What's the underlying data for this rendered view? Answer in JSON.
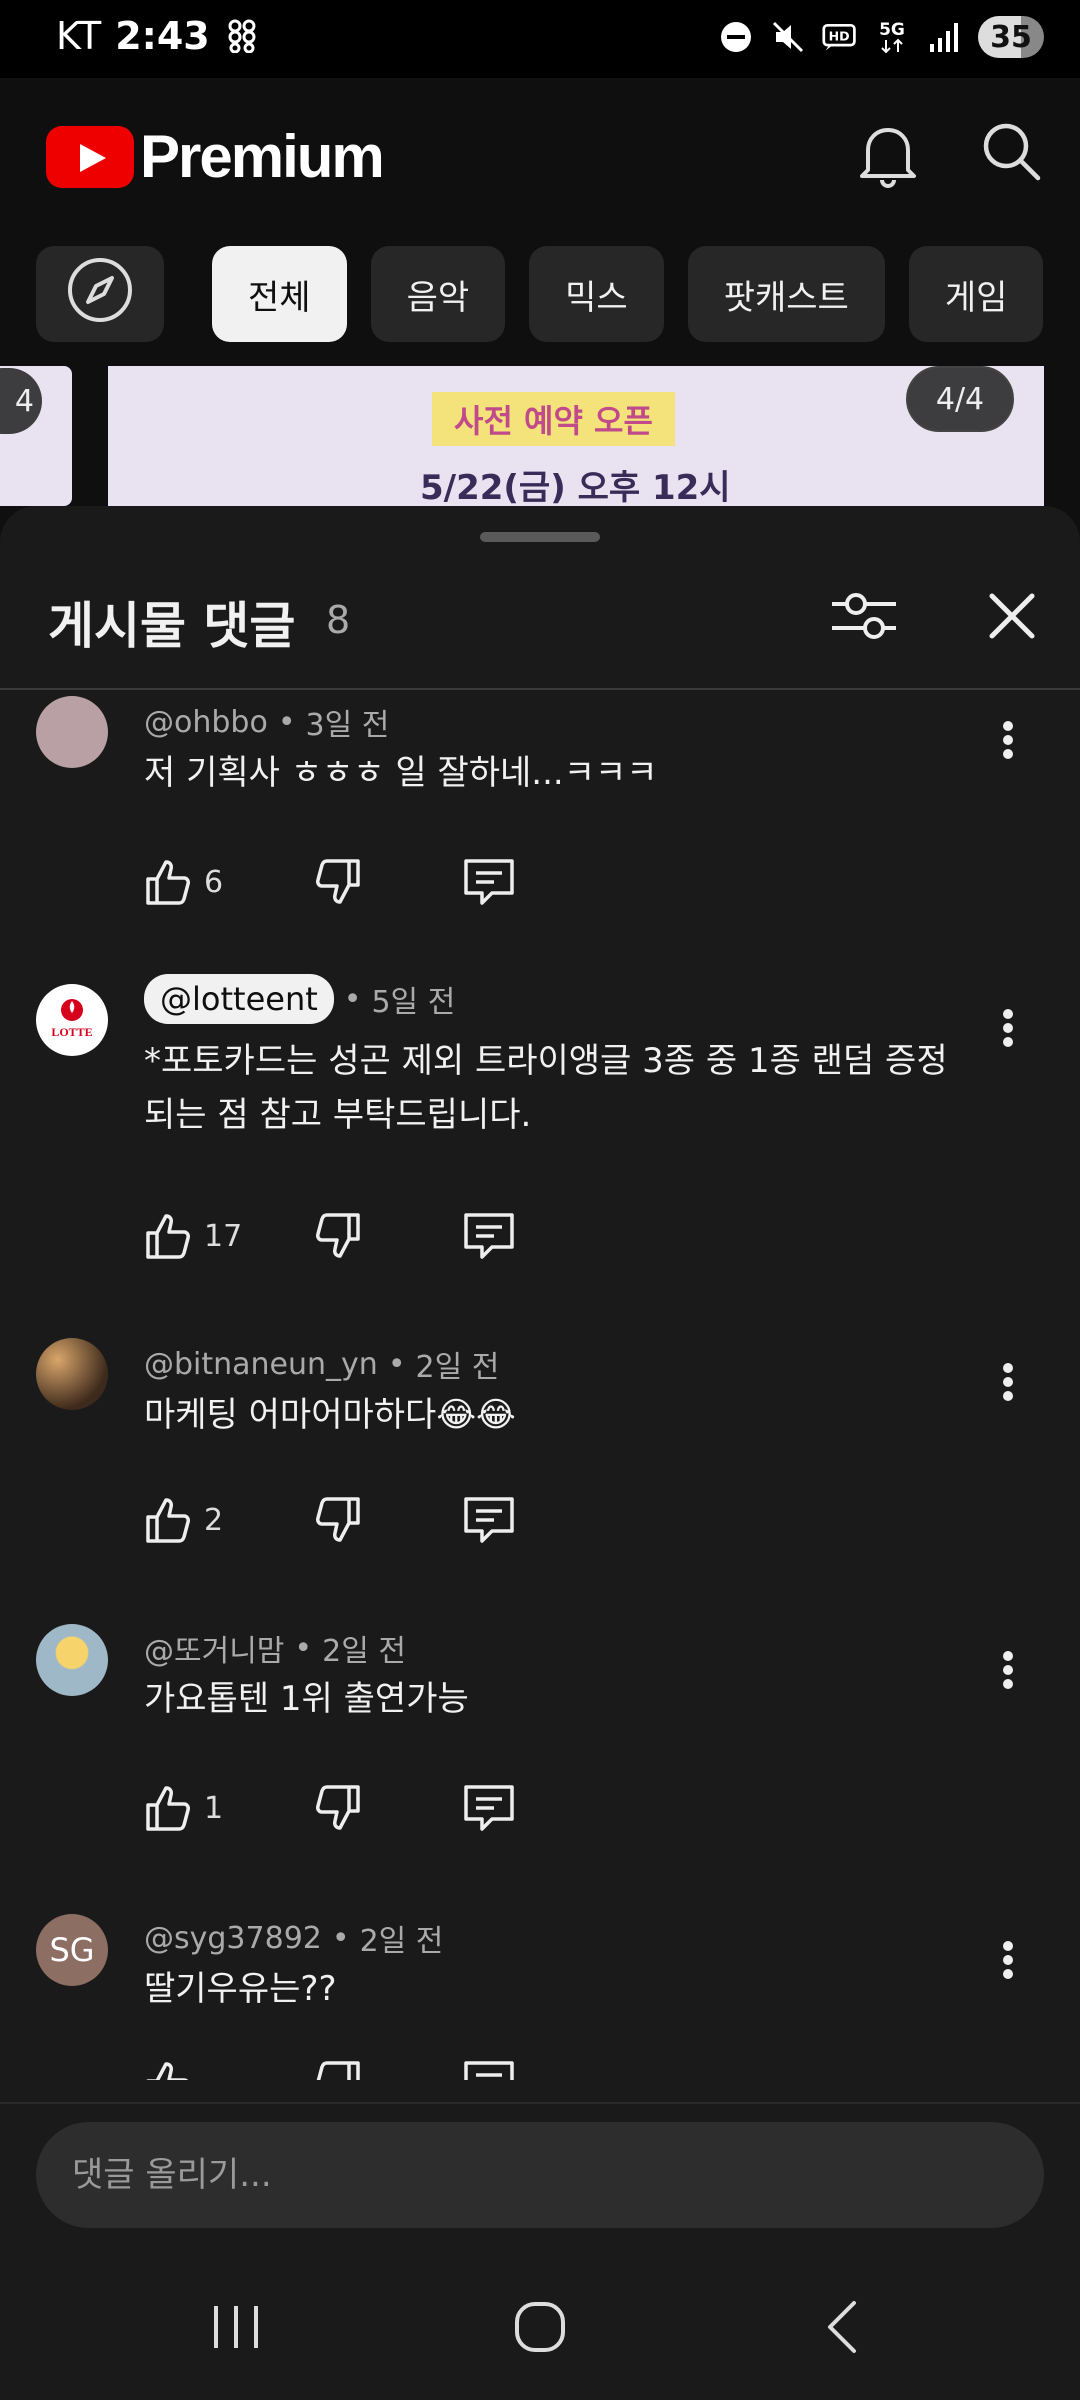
{
  "status_bar": {
    "carrier": "KT",
    "time": "2:43",
    "battery": "35"
  },
  "header": {
    "brand": "Premium"
  },
  "chips": [
    "전체",
    "음악",
    "믹스",
    "팟캐스트",
    "게임"
  ],
  "banner": {
    "line1": "사전 예약 오픈",
    "line2": "5/22(금) 오후 12시",
    "page_indicator": "4/4",
    "prev_indicator": "4"
  },
  "sheet": {
    "title": "게시물 댓글",
    "count": "8"
  },
  "comments": [
    {
      "author": "@ohbbo",
      "time": "3일 전",
      "text": "저 기획사 ㅎㅎㅎ 일 잘하네...ㅋㅋㅋ",
      "likes": "6",
      "avatar_text": "",
      "avatar_color": "#b8a0a4"
    },
    {
      "author": "@lotteent",
      "time": "5일 전",
      "text": "*포토카드는 성곤 제외 트라이앵글 3종 중 1종 랜덤 증정되는 점 참고 부탁드립니다.",
      "likes": "17",
      "avatar_text": "LOTTE",
      "avatar_color": "#ffffff",
      "highlighted_author": true
    },
    {
      "author": "@bitnaneun_yn",
      "time": "2일 전",
      "text": "마케팅 어마어마하다😂😂",
      "likes": "2",
      "avatar_text": "",
      "avatar_color": "#6a4a30"
    },
    {
      "author": "@또거니맘",
      "time": "2일 전",
      "text": "가요톱텐  1위 출연가능",
      "likes": "1",
      "avatar_text": "",
      "avatar_color": "#9fb8c8"
    },
    {
      "author": "@syg37892",
      "time": "2일 전",
      "text": "딸기우유는??",
      "likes": "",
      "avatar_text": "SG",
      "avatar_color": "#8d6e63"
    }
  ],
  "composer": {
    "placeholder": "댓글 올리기..."
  },
  "colors": {
    "background": "#0f0f0f",
    "sheet": "#1a1a1a",
    "brand_red": "#ff0000"
  }
}
